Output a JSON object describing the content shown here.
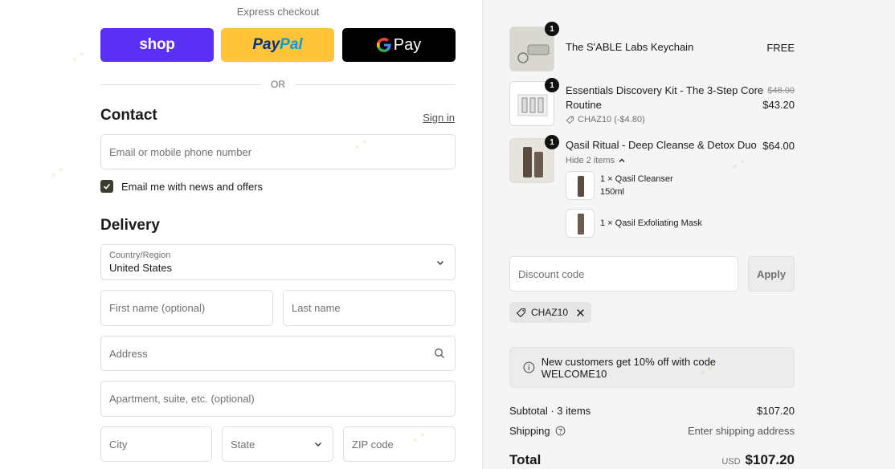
{
  "express": {
    "label": "Express checkout",
    "shop_label": "shop",
    "paypal_part1": "Pay",
    "paypal_part2": "Pal",
    "gpay_label": "Pay",
    "or_label": "OR"
  },
  "contact": {
    "title": "Contact",
    "signin_label": "Sign in",
    "email_placeholder": "Email or mobile phone number",
    "newsletter_label": "Email me with news and offers",
    "newsletter_checked": true
  },
  "delivery": {
    "title": "Delivery",
    "country_label": "Country/Region",
    "country_value": "United States",
    "first_name_placeholder": "First name (optional)",
    "last_name_placeholder": "Last name",
    "address_placeholder": "Address",
    "apartment_placeholder": "Apartment, suite, etc. (optional)",
    "city_placeholder": "City",
    "state_placeholder": "State",
    "zip_placeholder": "ZIP code"
  },
  "cart": {
    "items": [
      {
        "qty": "1",
        "name": "The S'ABLE Labs Keychain",
        "price": "FREE"
      },
      {
        "qty": "1",
        "name_line1": "Essentials Discovery Kit - The 3-Step Core",
        "name_line2": "Routine",
        "original_price": "$48.00",
        "price": "$43.20",
        "discount": "CHAZ10 (-$4.80)"
      },
      {
        "qty": "1",
        "name": "Qasil Ritual - Deep Cleanse & Detox Duo",
        "price": "$64.00",
        "toggle_label": "Hide 2 items",
        "sub_items": [
          {
            "name": "1 × Qasil Cleanser",
            "detail": "150ml"
          },
          {
            "name": "1 × Qasil Exfoliating Mask"
          }
        ]
      }
    ],
    "discount_placeholder": "Discount code",
    "apply_label": "Apply",
    "applied_code": "CHAZ10",
    "info_message": "New customers get 10% off with code WELCOME10",
    "subtotal_label": "Subtotal · 3 items",
    "subtotal_value": "$107.20",
    "shipping_label": "Shipping",
    "shipping_value": "Enter shipping address",
    "total_label": "Total",
    "currency": "USD",
    "total_value": "$107.20"
  },
  "colors": {
    "shop_purple": "#5a31f4",
    "paypal_yellow": "#ffc439",
    "gpay_black": "#000000",
    "checkbox_dark": "#3d3d2e"
  }
}
